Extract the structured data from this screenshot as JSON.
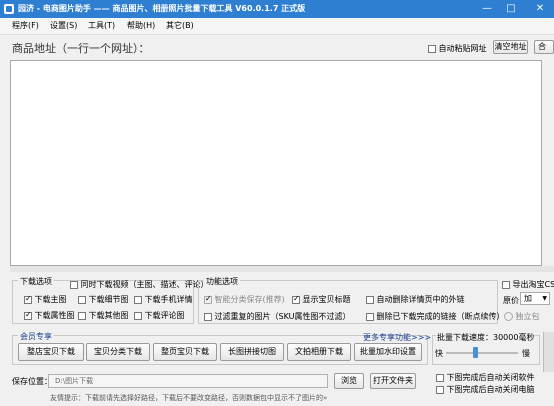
{
  "window": {
    "title": "园济 - 电商图片助手 —— 商品图片、相册照片批量下载工具  V60.0.1.7 正式版",
    "controls": {
      "minimize": "—",
      "maximize": "□",
      "close": "✕"
    }
  },
  "menu": [
    "程序(F)",
    "设置(S)",
    "工具(T)",
    "帮助(H)",
    "其它(B)"
  ],
  "url_section": {
    "header": "商品地址（一行一个网址）：",
    "auto_paste": "自动粘贴网址",
    "clear_button": "清空地址",
    "partial_button": "合"
  },
  "download_options": {
    "title": "下载选项",
    "sync_video": "同时下载视频（主图、描述、评论）",
    "items": [
      {
        "label": "下载主图",
        "checked": true
      },
      {
        "label": "下载细节图",
        "checked": false
      },
      {
        "label": "下载手机详情",
        "checked": false
      },
      {
        "label": "下载属性图",
        "checked": true
      },
      {
        "label": "下载其他图",
        "checked": false
      },
      {
        "label": "下载评论图",
        "checked": false
      }
    ]
  },
  "function_options": {
    "title": "功能选项",
    "items": [
      {
        "label": "智能分类保存(推荐)",
        "checked": true,
        "disabled": true
      },
      {
        "label": "显示宝贝标题",
        "checked": true,
        "disabled": false
      },
      {
        "label": "自动删除详情页中的外链",
        "checked": false,
        "disabled": false
      },
      {
        "label": "过滤重复的图片（SKU属性图不过滤）",
        "checked": false,
        "disabled": false
      },
      {
        "label": "删除已下载完成的链接（断点续传）",
        "checked": false,
        "disabled": false
      }
    ]
  },
  "export_options": {
    "export_taobao": "导出淘宝CS",
    "original_label": "原价",
    "original_value": "加",
    "standalone": "独立包"
  },
  "vip": {
    "title": "会员专享",
    "more": "更多专享功能>>>",
    "buttons": [
      "整店宝贝下载",
      "宝贝分类下载",
      "整页宝贝下载",
      "长图拼接切图",
      "文拍相册下载",
      "批量加水印设置"
    ]
  },
  "speed": {
    "label": "批量下载速度：",
    "value": "30000毫秒",
    "fast": "快",
    "slow": "慢",
    "level": 0.4
  },
  "save": {
    "label": "保存位置：",
    "path": "D:\\图片下载",
    "browse_button": "浏览",
    "open_button": "打开文件夹"
  },
  "after_done": {
    "close_software": "下图完成后自动关闭软件",
    "shutdown": "下图完成后自动关闭电脑"
  },
  "tip": "友情提示：下载前请先选择好路径，下载后不要改变路径，否则数据包中显示不了图片的»"
}
